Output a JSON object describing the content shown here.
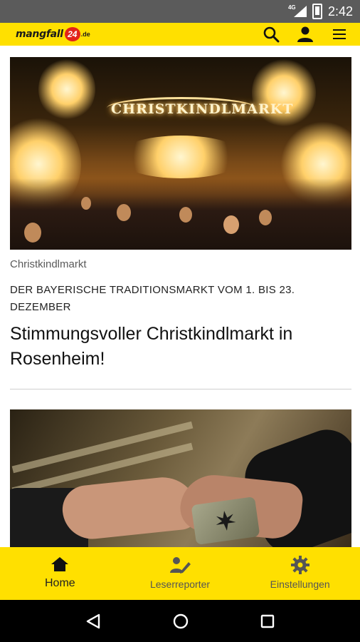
{
  "status_bar": {
    "network": "4G",
    "time": "2:42"
  },
  "app_bar": {
    "logo": {
      "text": "mangfall",
      "badge": "24",
      "tld": ".de"
    },
    "actions": [
      "search-icon",
      "account-icon",
      "menu-icon"
    ]
  },
  "articles": [
    {
      "image_text": "CHRISTKINDLMARKT",
      "category": "Christkindlmarkt",
      "kicker": "DER BAYERISCHE TRADITIONSMARKT VOM 1. BIS 23. DEZEMBER",
      "title": "Stimmungsvoller Christkindlmarkt in Rosenheim!"
    },
    {
      "image": "hands-exchange-photo"
    }
  ],
  "bottom_nav": {
    "items": [
      {
        "label": "Home",
        "icon": "home-icon",
        "active": true
      },
      {
        "label": "Leserreporter",
        "icon": "reporter-icon",
        "active": false
      },
      {
        "label": "Einstellungen",
        "icon": "gear-icon",
        "active": false
      }
    ]
  },
  "colors": {
    "accent": "#ffe000",
    "status_bar": "#5b5b5b",
    "nav_bar": "#000000"
  }
}
